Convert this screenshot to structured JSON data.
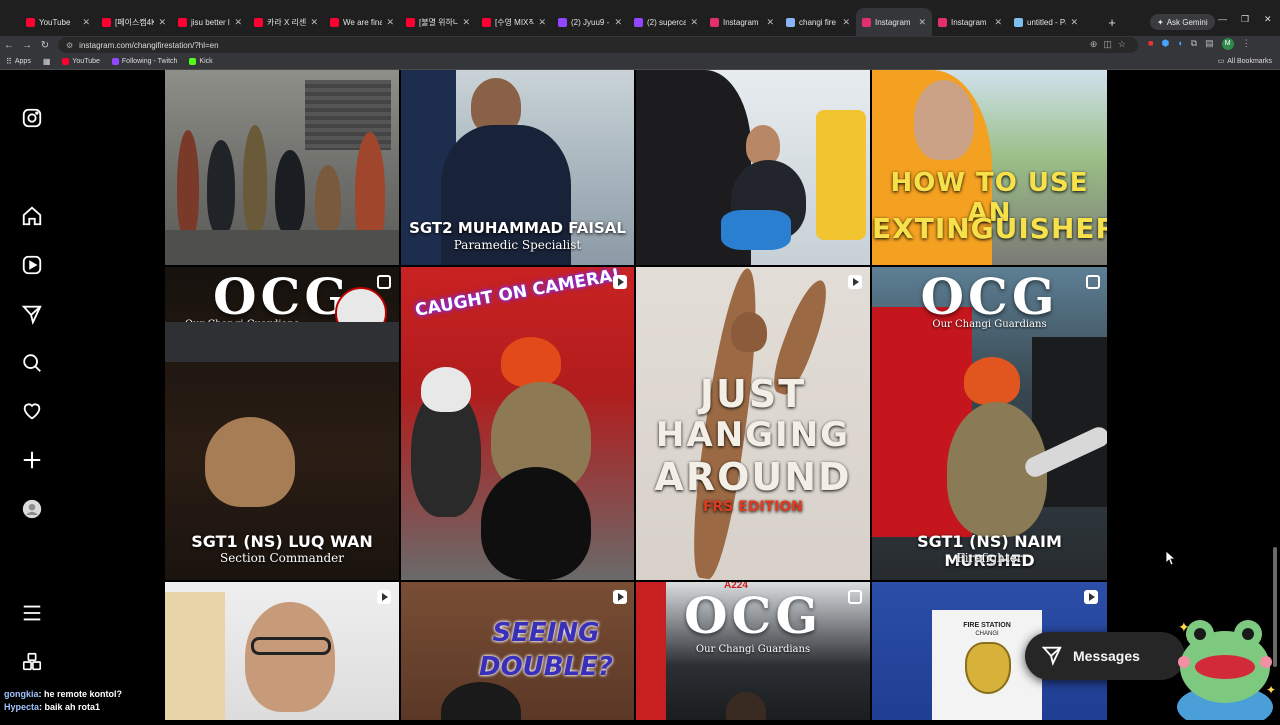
{
  "browser": {
    "tabs": [
      {
        "label": "YouTube",
        "color": "#ff0033",
        "active": false
      },
      {
        "label": "[페이스캠4K] 비",
        "color": "#ff0033",
        "active": false
      },
      {
        "label": "jisu better late",
        "color": "#ff0033",
        "active": false
      },
      {
        "label": "카라 X 리센느",
        "color": "#ff0033",
        "active": false
      },
      {
        "label": "We are finally",
        "color": "#ff0033",
        "active": false
      },
      {
        "label": "[불멸 위하나7]",
        "color": "#ff0033",
        "active": false
      },
      {
        "label": "[수영 MIX직캠]",
        "color": "#ff0033",
        "active": false
      },
      {
        "label": "(2) Jyuu9 - Twit",
        "color": "#9146ff",
        "active": false
      },
      {
        "label": "(2) supercatkei",
        "color": "#9146ff",
        "active": false
      },
      {
        "label": "Instagram",
        "color": "#e1306c",
        "active": false
      },
      {
        "label": "changi fire stati",
        "color": "#8ab4f8",
        "active": false
      },
      {
        "label": "Instagram",
        "color": "#e1306c",
        "active": true
      },
      {
        "label": "Instagram",
        "color": "#e1306c",
        "active": false
      },
      {
        "label": "untitled - Paint",
        "color": "#7ec0ee",
        "active": false
      }
    ],
    "new_tab": "+",
    "ask_gemini": "Ask Gemini",
    "url": "instagram.com/changifirestation/?hl=en",
    "profile_initial": "M",
    "bookmarks": {
      "apps": "Apps",
      "items": [
        {
          "label": "YouTube",
          "color": "#ff0033"
        },
        {
          "label": "Following - Twitch",
          "color": "#9146ff"
        },
        {
          "label": "Kick",
          "color": "#53fc18"
        }
      ],
      "all": "All Bookmarks"
    }
  },
  "sidebar": {
    "icons": [
      "instagram-logo-icon",
      "home-icon",
      "reels-icon",
      "send-icon",
      "search-icon",
      "heart-icon",
      "create-icon",
      "profile-avatar-icon",
      "menu-icon",
      "apps-icon"
    ]
  },
  "posts": [
    {
      "id": "p1",
      "caption": "",
      "subcaption": ""
    },
    {
      "id": "p2",
      "caption": "SGT2 MUHAMMAD FAISAL",
      "subcaption": "Paramedic Specialist"
    },
    {
      "id": "p3",
      "caption": "",
      "subcaption": ""
    },
    {
      "id": "p4",
      "caption": "HOW TO USE AN",
      "subcaption": "EXTINGUISHER"
    },
    {
      "id": "p5",
      "ocg": "OCG",
      "ocg_sub": "Our Changi Guardians",
      "caption": "SGT1 (NS) LUQ WAN",
      "subcaption": "Section Commander",
      "badge": "multi"
    },
    {
      "id": "p6",
      "caption": "CAUGHT ON CAMERA!",
      "badge": "reel"
    },
    {
      "id": "p7",
      "caption": "JUST",
      "caption2": "HANGING",
      "caption3": "AROUND",
      "subcaption": "FRS EDITION",
      "badge": "reel"
    },
    {
      "id": "p8",
      "ocg": "OCG",
      "ocg_sub": "Our Changi Guardians",
      "caption": "SGT1 (NS) NAIM MURSHED",
      "subcaption": "Firefighter",
      "badge": "multi"
    },
    {
      "id": "p9",
      "badge": "reel"
    },
    {
      "id": "p10",
      "caption": "SEEING",
      "caption2": "DOUBLE?",
      "badge": "reel"
    },
    {
      "id": "p11",
      "ocg": "OCG",
      "ocg_sub": "Our Changi Guardians",
      "badge": "multi",
      "vehicle": "A224"
    },
    {
      "id": "p12",
      "sign_top": "FIRE STATION",
      "sign_sub": "CHANGI",
      "badge": "reel"
    }
  ],
  "messages": {
    "label": "Messages"
  },
  "chat": [
    {
      "user": "gongkia",
      "text": "he remote kontol?"
    },
    {
      "user": "Hypecta",
      "text": "baik ah rota1"
    }
  ]
}
